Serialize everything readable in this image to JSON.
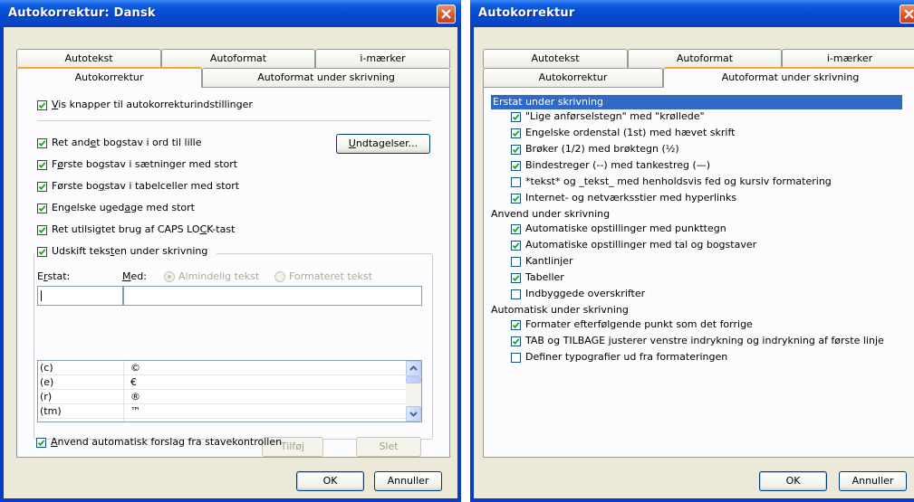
{
  "window1": {
    "title": "Autokorrektur: Dansk",
    "tabs_back": [
      "Autotekst",
      "Autoformat",
      "i-mærker"
    ],
    "tabs_front": [
      "Autokorrektur",
      "Autoformat under skrivning"
    ],
    "options": {
      "show_buttons": "Vis knapper til autokorrekturindstillinger",
      "two_initial_caps": "Ret andet bogstav i ord til lille",
      "capitalize_sentences": "Første bogstav i sætninger med stort",
      "capitalize_table_cells": "Første bogstav i tabelceller med stort",
      "capitalize_days": "Engelske ugedage med stort",
      "caps_lock": "Ret utilsigtet brug af CAPS LOCK-tast",
      "replace_text": "Udskift teksten under skrivning",
      "auto_suggest": "Anvend automatisk forslag fra stavekontrollen"
    },
    "exceptions_button": "Undtagelser...",
    "replace_label": "Erstat:",
    "with_label": "Med:",
    "radio_plain": "Almindelig tekst",
    "radio_formatted": "Formateret tekst",
    "replace_value": "",
    "with_value": "",
    "list_rows": [
      {
        "from": "(c)",
        "to": "©"
      },
      {
        "from": "(e)",
        "to": "€"
      },
      {
        "from": "(r)",
        "to": "®"
      },
      {
        "from": "(tm)",
        "to": "™"
      }
    ],
    "add_button": "Tilføj",
    "delete_button": "Slet",
    "ok_button": "OK",
    "cancel_button": "Annuller"
  },
  "window2": {
    "title": "Autokorrektur",
    "tabs_back": [
      "Autotekst",
      "Autoformat",
      "i-mærker"
    ],
    "tabs_front": [
      "Autokorrektur",
      "Autoformat under skrivning"
    ],
    "groups": [
      {
        "header": "Erstat under skrivning",
        "items": [
          {
            "label": "\"Lige anførselstegn\" med \"krøllede\"",
            "checked": true
          },
          {
            "label": "Engelske ordenstal (1st) med hævet skrift",
            "checked": true
          },
          {
            "label": "Brøker (1/2) med brøktegn (½)",
            "checked": true
          },
          {
            "label": "Bindestreger (--) med tankestreg (—)",
            "checked": true
          },
          {
            "label": "*tekst* og _tekst_ med henholdsvis fed og kursiv formatering",
            "checked": false
          },
          {
            "label": "Internet- og netværksstier med hyperlinks",
            "checked": true
          }
        ]
      },
      {
        "header": "Anvend under skrivning",
        "items": [
          {
            "label": "Automatiske opstillinger med punkttegn",
            "checked": true
          },
          {
            "label": "Automatiske opstillinger med tal og bogstaver",
            "checked": true
          },
          {
            "label": "Kantlinjer",
            "checked": false
          },
          {
            "label": "Tabeller",
            "checked": true
          },
          {
            "label": "Indbyggede overskrifter",
            "checked": false
          }
        ]
      },
      {
        "header": "Automatisk under skrivning",
        "items": [
          {
            "label": "Formater efterfølgende punkt som det forrige",
            "checked": true
          },
          {
            "label": "TAB og TILBAGE justerer venstre indrykning og indrykning af første linje",
            "checked": true
          },
          {
            "label": "Definer typografier ud fra formateringen",
            "checked": false
          }
        ]
      }
    ],
    "ok_button": "OK",
    "cancel_button": "Annuller"
  }
}
